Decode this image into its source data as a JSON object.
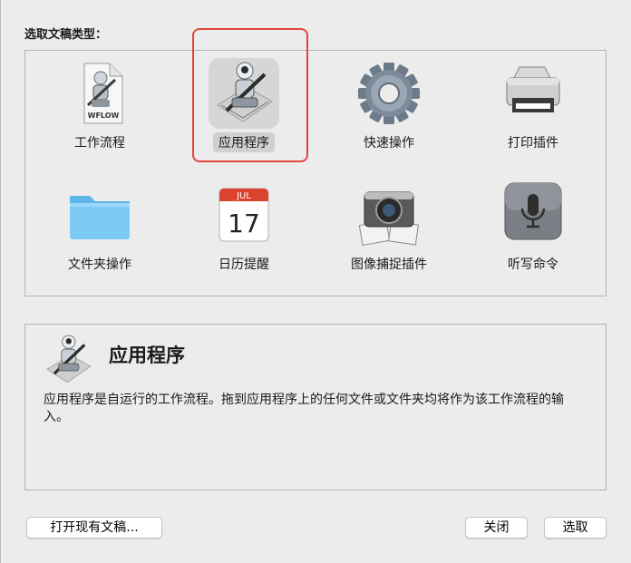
{
  "header": {
    "label": "选取文稿类型："
  },
  "doc_types": [
    {
      "label": "工作流程",
      "icon": "workflow-file-icon"
    },
    {
      "label": "应用程序",
      "icon": "automator-robot-icon",
      "selected": true
    },
    {
      "label": "快速操作",
      "icon": "gear-icon"
    },
    {
      "label": "打印插件",
      "icon": "printer-icon"
    },
    {
      "label": "文件夹操作",
      "icon": "folder-icon"
    },
    {
      "label": "日历提醒",
      "icon": "calendar-icon"
    },
    {
      "label": "图像捕捉插件",
      "icon": "camera-icon"
    },
    {
      "label": "听写命令",
      "icon": "microphone-icon"
    }
  ],
  "workflow_icon_text": "WFLOW",
  "calendar": {
    "month": "JUL",
    "day": "17"
  },
  "description": {
    "title": "应用程序",
    "text": "应用程序是自运行的工作流程。拖到应用程序上的任何文件或文件夹均将作为该工作流程的输入。"
  },
  "buttons": {
    "open_existing": "打开现有文稿...",
    "close": "关闭",
    "choose": "选取"
  },
  "colors": {
    "highlight": "#e0473a"
  }
}
